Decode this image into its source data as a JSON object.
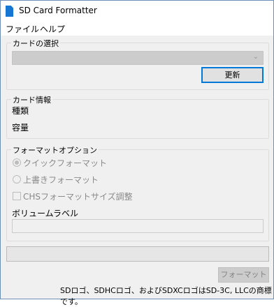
{
  "window": {
    "title": "SD Card Formatter",
    "icon": "sd-card-icon"
  },
  "menu": {
    "file": "ファイル",
    "help": "ヘルプ"
  },
  "card_select": {
    "group_title": "カードの選択",
    "dropdown_value": "",
    "refresh_label": "更新"
  },
  "card_info": {
    "group_title": "カード情報",
    "type_label": "種類",
    "capacity_label": "容量"
  },
  "format_options": {
    "group_title": "フォーマットオプション",
    "quick_format": "クイックフォーマット",
    "quick_format_selected": true,
    "overwrite_format": "上書きフォーマット",
    "overwrite_format_selected": false,
    "chs_adjust": "CHSフォーマットサイズ調整",
    "chs_adjust_checked": false,
    "volume_label_title": "ボリュームラベル",
    "volume_label_value": ""
  },
  "progress": {
    "value": 0
  },
  "actions": {
    "format_label": "フォーマット"
  },
  "footer": {
    "trademark": "SDロゴ、SDHCロゴ、およびSDXCロゴはSD-3C, LLCの商標です。"
  },
  "colors": {
    "accent": "#0078d7",
    "icon": "#1577d3",
    "disabled": "#8a8a8a"
  }
}
